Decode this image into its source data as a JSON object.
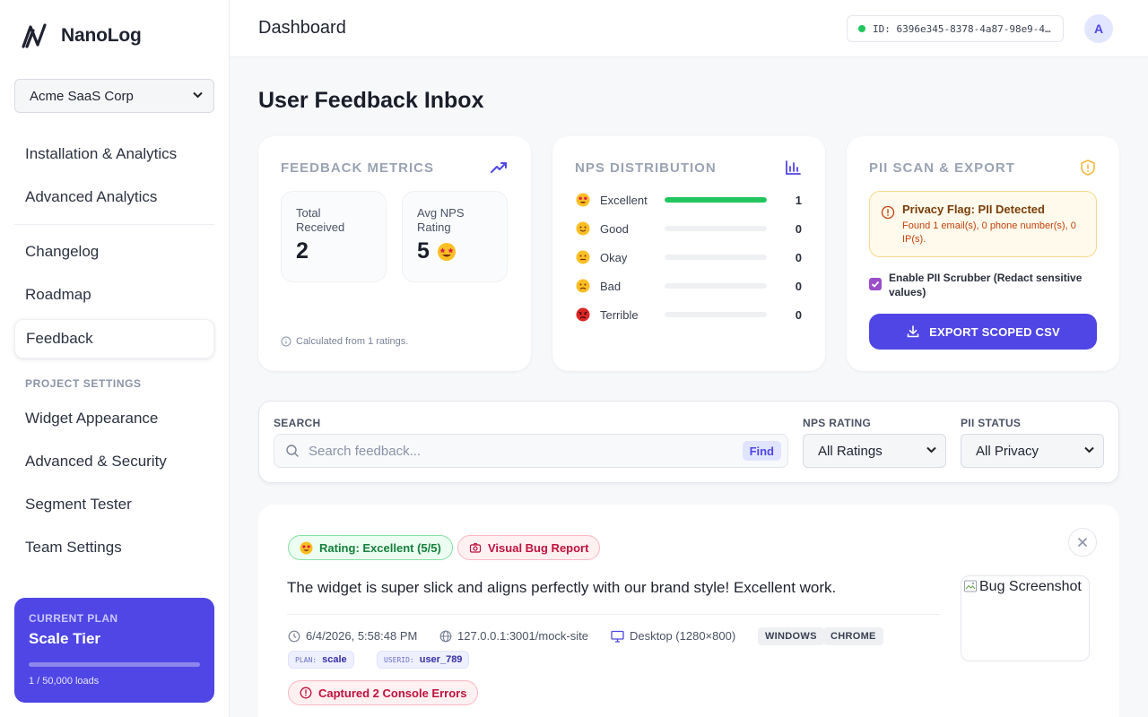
{
  "brand": {
    "name": "NanoLog"
  },
  "org_select": {
    "value": "Acme SaaS Corp"
  },
  "nav": {
    "items": [
      {
        "label": "Installation & Analytics"
      },
      {
        "label": "Advanced Analytics"
      },
      {
        "label": "Changelog"
      },
      {
        "label": "Roadmap"
      },
      {
        "label": "Feedback",
        "active": true
      }
    ],
    "section_label": "PROJECT SETTINGS",
    "settings_items": [
      {
        "label": "Widget Appearance"
      },
      {
        "label": "Advanced & Security"
      },
      {
        "label": "Segment Tester"
      },
      {
        "label": "Team Settings"
      }
    ]
  },
  "plan": {
    "label": "CURRENT PLAN",
    "name": "Scale Tier",
    "usage": "1 / 50,000 loads",
    "usage_fraction": 2e-05
  },
  "header": {
    "title": "Dashboard",
    "id_text": "ID: 6396e345-8378-4a87-98e9-4…",
    "avatar_initial": "A"
  },
  "page": {
    "title": "User Feedback Inbox"
  },
  "metrics_card": {
    "title": "FEEDBACK METRICS",
    "total_label": "Total Received",
    "total_value": "2",
    "nps_label": "Avg NPS Rating",
    "nps_value": "5",
    "footnote": "Calculated from 1 ratings."
  },
  "nps_card": {
    "title": "NPS DISTRIBUTION",
    "rows": [
      {
        "label": "Excellent",
        "count": "1",
        "fraction": 1.0,
        "emoji": "star-struck"
      },
      {
        "label": "Good",
        "count": "0",
        "fraction": 0,
        "emoji": "smile"
      },
      {
        "label": "Okay",
        "count": "0",
        "fraction": 0,
        "emoji": "neutral"
      },
      {
        "label": "Bad",
        "count": "0",
        "fraction": 0,
        "emoji": "frown"
      },
      {
        "label": "Terrible",
        "count": "0",
        "fraction": 0,
        "emoji": "angry"
      }
    ]
  },
  "pii_card": {
    "title": "PII SCAN & EXPORT",
    "alert_title": "Privacy Flag: PII Detected",
    "alert_text": "Found 1 email(s), 0 phone number(s), 0 IP(s).",
    "scrubber_label": "Enable PII Scrubber (Redact sensitive values)",
    "scrubber_checked": true,
    "export_label": "EXPORT SCOPED CSV"
  },
  "filters": {
    "search_label": "SEARCH",
    "search_placeholder": "Search feedback...",
    "find_label": "Find",
    "nps_label": "NPS RATING",
    "nps_value": "All Ratings",
    "pii_label": "PII STATUS",
    "pii_value": "All Privacy"
  },
  "feedback_item": {
    "rating_pill": "Rating: Excellent (5/5)",
    "bug_pill": "Visual Bug Report",
    "text": "The widget is super slick and aligns perfectly with our brand style! Excellent work.",
    "timestamp": "6/4/2026, 5:58:48 PM",
    "url": "127.0.0.1:3001/mock-site",
    "device": "Desktop (1280×800)",
    "os_tag": "WINDOWS",
    "browser_tag": "CHROME",
    "plan_key": "PLAN:",
    "plan_value": "scale",
    "userid_key": "USERID:",
    "userid_value": "user_789",
    "console_pill": "Captured 2 Console Errors",
    "screenshot_alt": "Bug Screenshot"
  },
  "colors": {
    "accent": "#4f46e5",
    "success": "#22c55e",
    "danger": "#be123c",
    "warning_bg": "#fffaeb"
  }
}
